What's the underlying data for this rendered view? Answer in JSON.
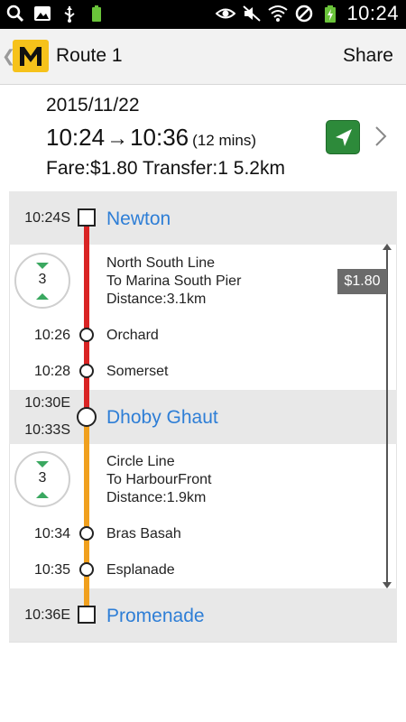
{
  "status_bar": {
    "time": "10:24",
    "left_icons": [
      "search-icon",
      "photo-icon",
      "usb-icon",
      "battery-saver-icon"
    ],
    "right_icons": [
      "eye-icon",
      "mute-icon",
      "wifi-icon",
      "no-sim-icon",
      "battery-charging-icon"
    ]
  },
  "action_bar": {
    "back_glyph": "❮",
    "title": "Route 1",
    "share_label": "Share",
    "logo_letter": "M",
    "logo_color": "#f6c21b"
  },
  "summary": {
    "date": "2015/11/22",
    "depart": "10:24",
    "arrow": "→",
    "arrive": "10:36",
    "duration": "(12 mins)",
    "fare_line": "Fare:$1.80 Transfer:1 5.2km"
  },
  "route": {
    "fare_tag": "$1.80",
    "stations": {
      "start": {
        "time": "10:24S",
        "name": "Newton"
      },
      "transfer": {
        "time_arrive": "10:30E",
        "time_depart": "10:33S",
        "name": "Dhoby Ghaut"
      },
      "end": {
        "time": "10:36E",
        "name": "Promenade"
      }
    },
    "legs": [
      {
        "stops_count": "3",
        "line": "North South Line",
        "direction": "To Marina South Pier",
        "distance": "Distance:3.1km",
        "color": "#d92424",
        "intermediate": [
          {
            "time": "10:26",
            "name": "Orchard"
          },
          {
            "time": "10:28",
            "name": "Somerset"
          }
        ]
      },
      {
        "stops_count": "3",
        "line": "Circle Line",
        "direction": "To HarbourFront",
        "distance": "Distance:1.9km",
        "color": "#f0a01e",
        "intermediate": [
          {
            "time": "10:34",
            "name": "Bras Basah"
          },
          {
            "time": "10:35",
            "name": "Esplanade"
          }
        ]
      }
    ]
  },
  "colors": {
    "station_link": "#2e7ed6",
    "nav_button": "#2d8a3a",
    "count_arrows": "#3aa860"
  }
}
